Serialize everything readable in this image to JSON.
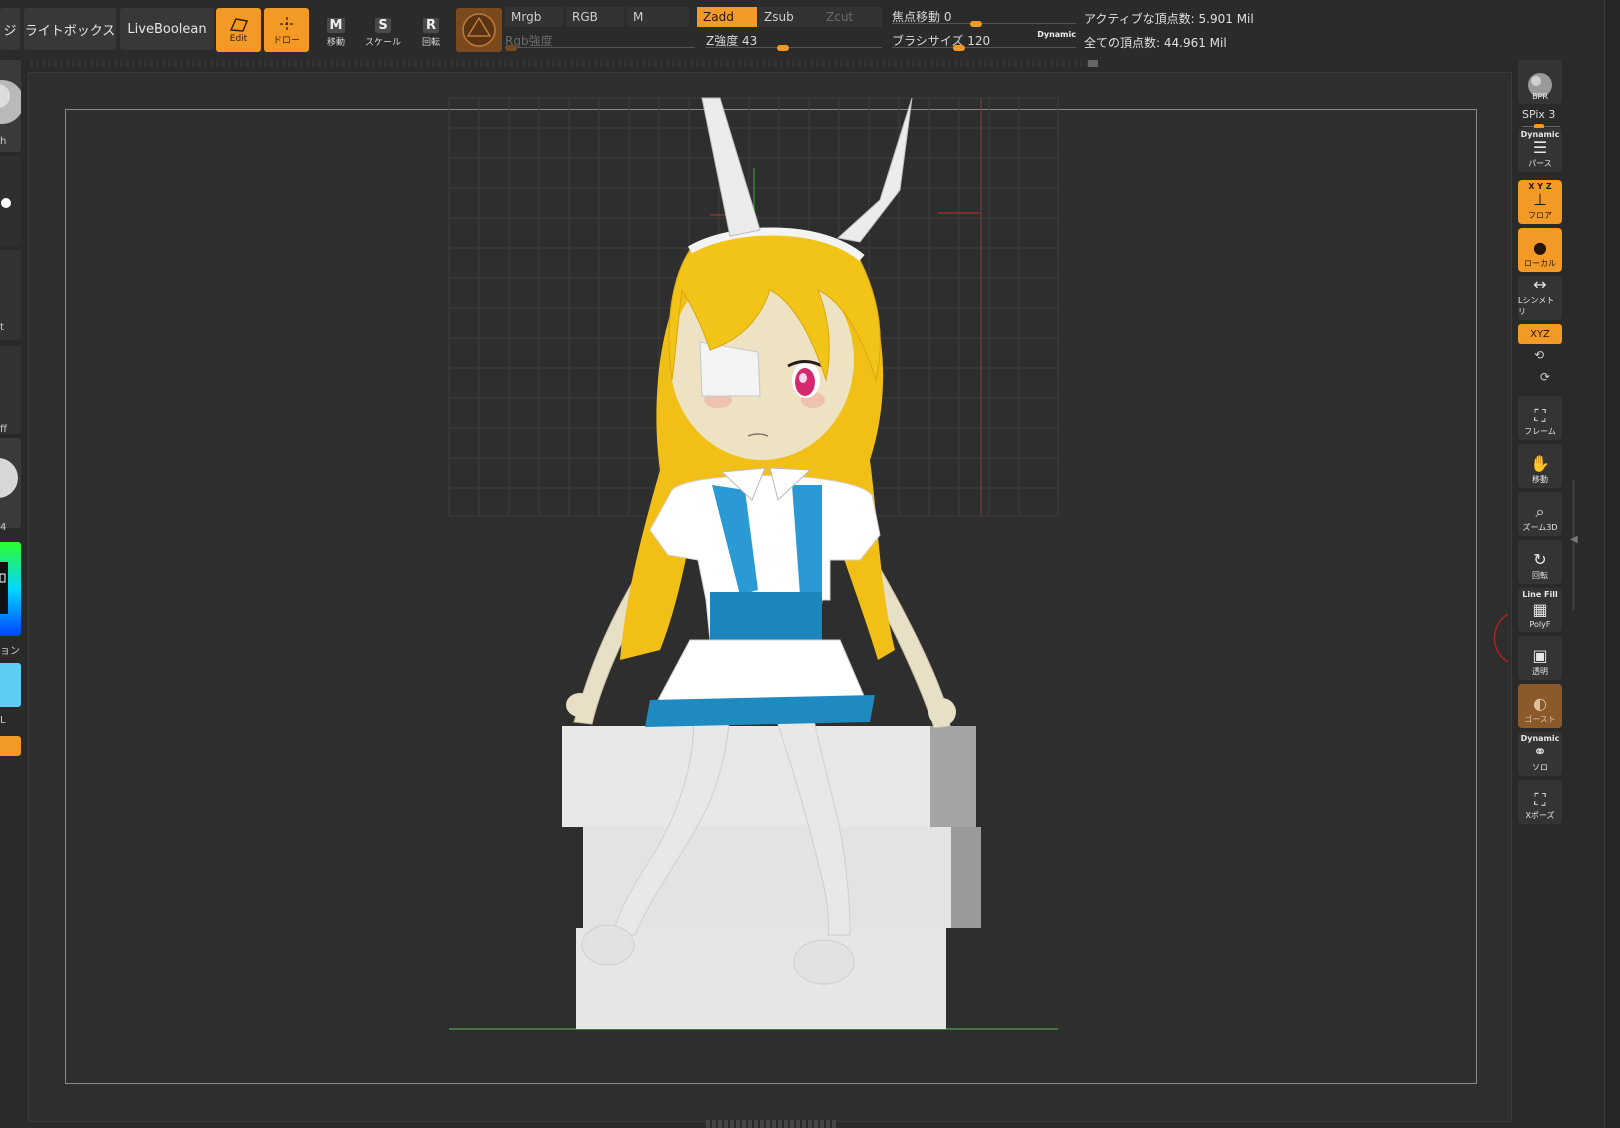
{
  "toolbar": {
    "cut_left_label": "ジ",
    "lightbox_label": "ライトボックス",
    "liveboolean_label": "LiveBoolean",
    "edit_label": "Edit",
    "draw_label": "ドロー",
    "move_label": "移動",
    "move_key": "M",
    "scale_label": "スケール",
    "scale_key": "S",
    "rotate_label": "回転",
    "rotate_key": "R",
    "mrgb_label": "Mrgb",
    "rgb_label": "RGB",
    "m_label": "M",
    "rgb_intensity_label": "Rgb強度",
    "zadd_label": "Zadd",
    "zsub_label": "Zsub",
    "zcut_label": "Zcut",
    "z_intensity": "Z強度 43",
    "focal_shift": "焦点移動 0",
    "brush_size": "ブラシサイズ 120",
    "dynamic_label": "Dynamic",
    "active_points": "アクティブな頂点数: 5.901 Mil",
    "total_points": "全ての頂点数: 44.961 Mil"
  },
  "sliders": {
    "rgb_intensity": 0.0,
    "z_intensity": 0.43,
    "focal_shift": 0.0,
    "brush_size": 0.12
  },
  "left_panel": {
    "brush_label": "h",
    "alpha_label": "t",
    "stroke_label": "ff",
    "material_label": "4",
    "color_label": "ョン",
    "misc_label": "L"
  },
  "right_shelf": {
    "bpr": "BPR",
    "spix": "SPix 3",
    "perspective_cap": "Dynamic",
    "perspective": "パース",
    "floor_cap": "X Y Z",
    "floor": "フロア",
    "local": "ローカル",
    "lsym": "Lシンメトリ",
    "xyz": "XYZ",
    "frame": "フレーム",
    "move": "移動",
    "zoom": "ズーム3D",
    "rotate": "回転",
    "polyf_cap": "Line Fill",
    "polyf": "PolyF",
    "transp": "透明",
    "ghost": "ゴースト",
    "solo_cap": "Dynamic",
    "solo": "ソロ",
    "xpose": "Xポーズ"
  },
  "colors": {
    "accent": "#f39a26",
    "panel": "#383838",
    "canvas": "#2e2e2e",
    "hair": "#f2c21a",
    "dress": "#1e8fc4",
    "skin": "#ece3c9",
    "eye": "#d4286f"
  }
}
